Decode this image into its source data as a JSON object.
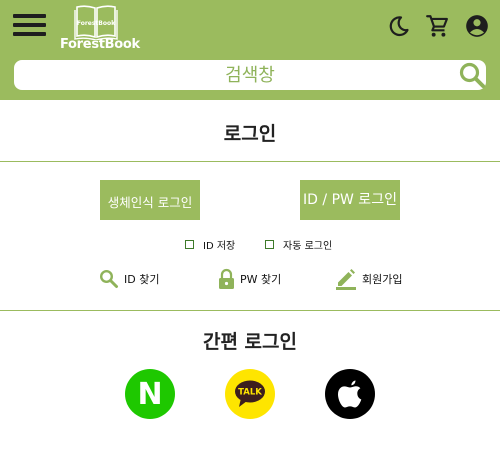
{
  "header": {
    "brand_name": "ForestBook",
    "logo_text": "ForestBook",
    "color": "#9bbb5e",
    "icons": [
      "menu-icon",
      "dark-mode-moon-icon",
      "cart-icon",
      "account-icon"
    ]
  },
  "search": {
    "placeholder": "검색창"
  },
  "login": {
    "title": "로그인",
    "biometric_button": "생체인식 로그인",
    "idpw_button": "ID / PW 로그인",
    "save_id_label": "ID 저장",
    "auto_login_label": "자동 로그인",
    "find_id_label": "ID 찾기",
    "find_pw_label": "PW 찾기",
    "signup_label": "회원가입"
  },
  "simple_login": {
    "title": "간편 로그인",
    "naver_letter": "N",
    "kakao_label": "TALK",
    "providers": [
      "naver",
      "kakao",
      "apple"
    ]
  }
}
